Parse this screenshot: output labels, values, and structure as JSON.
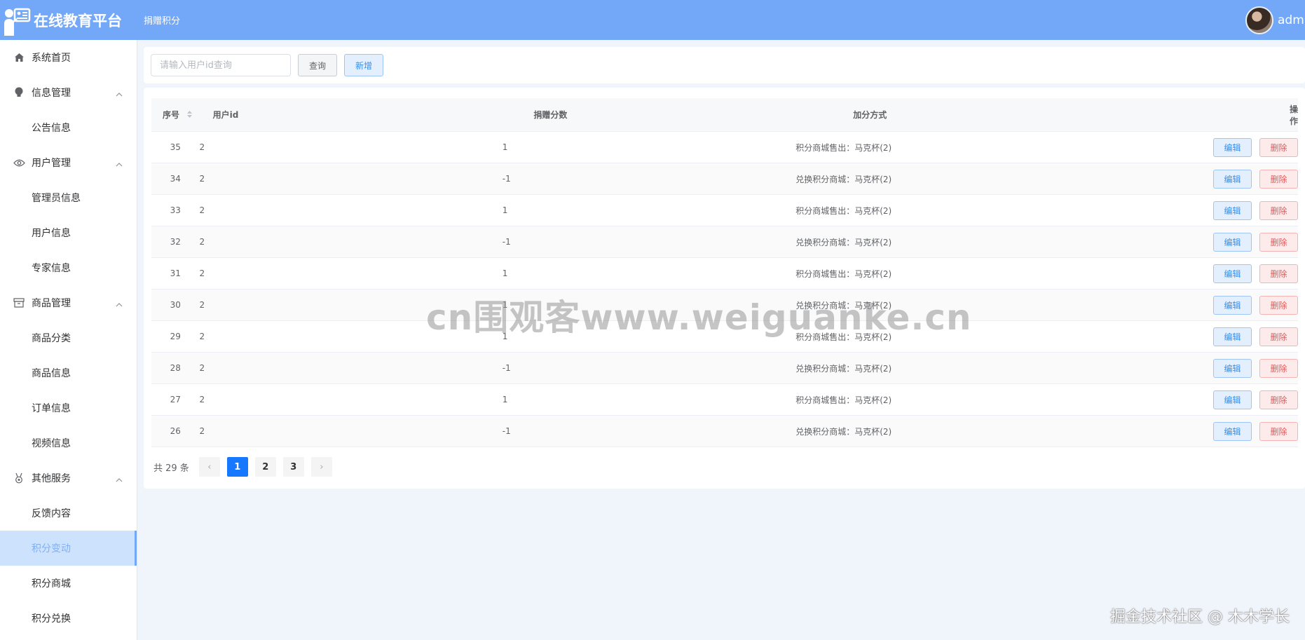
{
  "header": {
    "app_title": "在线教育平台",
    "breadcrumb": "捐赠积分",
    "username": "admin"
  },
  "sidebar": {
    "items": [
      {
        "label": "系统首页",
        "icon": "home-icon",
        "type": "top"
      },
      {
        "label": "信息管理",
        "icon": "bulb-icon",
        "type": "group"
      },
      {
        "label": "公告信息",
        "type": "sub"
      },
      {
        "label": "用户管理",
        "icon": "eye-icon",
        "type": "group"
      },
      {
        "label": "管理员信息",
        "type": "sub"
      },
      {
        "label": "用户信息",
        "type": "sub"
      },
      {
        "label": "专家信息",
        "type": "sub"
      },
      {
        "label": "商品管理",
        "icon": "box-icon",
        "type": "group"
      },
      {
        "label": "商品分类",
        "type": "sub"
      },
      {
        "label": "商品信息",
        "type": "sub"
      },
      {
        "label": "订单信息",
        "type": "sub"
      },
      {
        "label": "视频信息",
        "type": "sub"
      },
      {
        "label": "其他服务",
        "icon": "medal-icon",
        "type": "group"
      },
      {
        "label": "反馈内容",
        "type": "sub"
      },
      {
        "label": "积分变动",
        "type": "sub",
        "active": true
      },
      {
        "label": "积分商城",
        "type": "sub"
      },
      {
        "label": "积分兑换",
        "type": "sub"
      }
    ]
  },
  "search": {
    "placeholder": "请输入用户id查询",
    "value": "",
    "query_label": "查询",
    "add_label": "新增"
  },
  "table": {
    "columns": [
      "序号",
      "用户id",
      "捐赠分数",
      "加分方式",
      "操作"
    ],
    "edit_label": "编辑",
    "delete_label": "删除",
    "rows": [
      {
        "no": "35",
        "uid": "2",
        "score": "1",
        "method": "积分商城售出：马克杯(2)"
      },
      {
        "no": "34",
        "uid": "2",
        "score": "-1",
        "method": "兑换积分商城：马克杯(2)"
      },
      {
        "no": "33",
        "uid": "2",
        "score": "1",
        "method": "积分商城售出：马克杯(2)"
      },
      {
        "no": "32",
        "uid": "2",
        "score": "-1",
        "method": "兑换积分商城：马克杯(2)"
      },
      {
        "no": "31",
        "uid": "2",
        "score": "1",
        "method": "积分商城售出：马克杯(2)"
      },
      {
        "no": "30",
        "uid": "2",
        "score": "1",
        "method": "兑换积分商城：马克杯(2)"
      },
      {
        "no": "29",
        "uid": "2",
        "score": "1",
        "method": "积分商城售出：马克杯(2)"
      },
      {
        "no": "28",
        "uid": "2",
        "score": "-1",
        "method": "兑换积分商城：马克杯(2)"
      },
      {
        "no": "27",
        "uid": "2",
        "score": "1",
        "method": "积分商城售出：马克杯(2)"
      },
      {
        "no": "26",
        "uid": "2",
        "score": "-1",
        "method": "兑换积分商城：马克杯(2)"
      }
    ]
  },
  "pagination": {
    "total_text": "共 29 条",
    "pages": [
      "1",
      "2",
      "3"
    ],
    "current": "1",
    "prev": "‹",
    "next": "›"
  },
  "watermarks": {
    "center": "cn围观客www.weiguanke.cn",
    "corner": "掘金技术社区 @ 木木学长"
  },
  "colors": {
    "header_bg": "#73a8f8",
    "primary": "#1677ff",
    "danger": "#e15b5b",
    "active_menu_bg": "#cde2fd"
  }
}
